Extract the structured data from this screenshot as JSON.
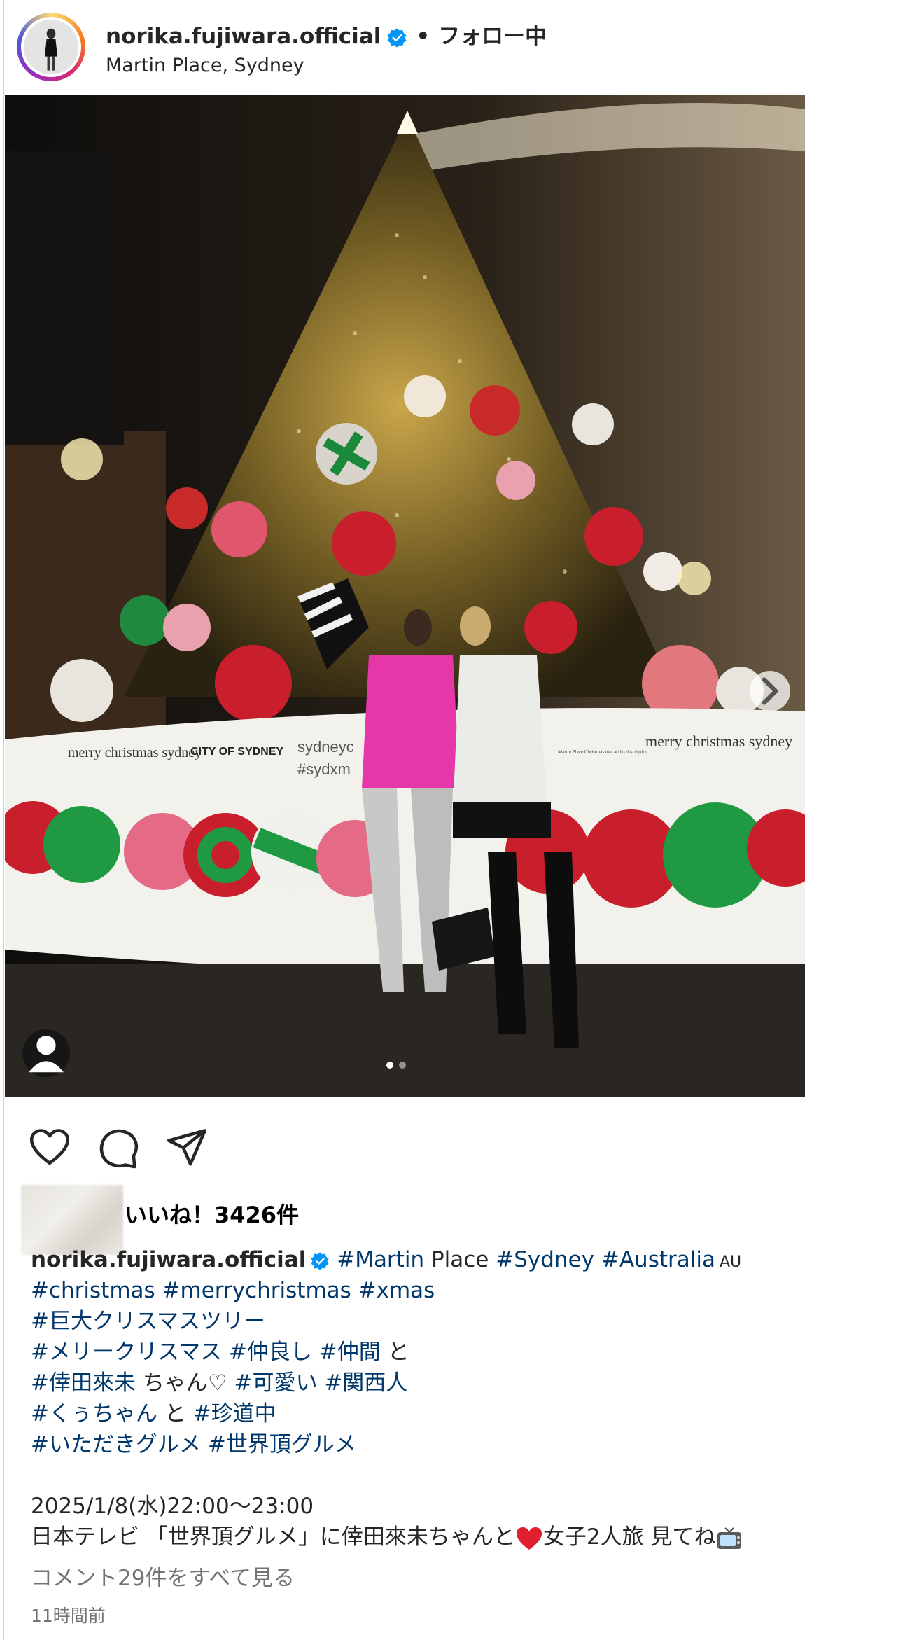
{
  "header": {
    "username": "norika.fujiwara.official",
    "separator": "•",
    "follow_state": "フォロー中",
    "location": "Martin Place, Sydney"
  },
  "photo": {
    "alt_subject": "christmas-tree",
    "banner_text_left": "merry christmas sydney",
    "banner_text_city": "CITY OF SYDNEY",
    "banner_text_mid_1": "sydneyc",
    "banner_text_mid_2": "#sydxm",
    "banner_text_sign": "Martin Place Christmas tree audio description",
    "banner_text_right": "merry christmas sydney",
    "carousel": {
      "count": 2,
      "active": 1
    }
  },
  "actions": {
    "like_icon": "heart-icon",
    "comment_icon": "comment-icon",
    "share_icon": "paper-plane-icon"
  },
  "likes": {
    "label": "いいね！3426件"
  },
  "caption": {
    "username": "norika.fujiwara.official",
    "line1": {
      "t1": "#Martin",
      "t2": " Place ",
      "t3": "#Sydney",
      "t4": " ",
      "t5": "#Australia",
      "t6": "AU"
    },
    "line2": {
      "t1": "#christmas",
      "t2": " ",
      "t3": "#merrychristmas",
      "t4": " ",
      "t5": "#xmas"
    },
    "line3": {
      "t1": "#巨大クリスマスツリー"
    },
    "line4": {
      "t1": "#メリークリスマス",
      "t2": " ",
      "t3": "#仲良し",
      "t4": " ",
      "t5": "#仲間",
      "t6": " と"
    },
    "line5": {
      "t1": "#倖田來未",
      "t2": " ちゃん♡ ",
      "t3": "#可愛い",
      "t4": " ",
      "t5": "#関西人"
    },
    "line6": {
      "t1": "#くぅちゃん",
      "t2": " と ",
      "t3": "#珍道中"
    },
    "line7": {
      "t1": "#いただきグルメ",
      "t2": " ",
      "t3": "#世界頂グルメ"
    },
    "line8": "2025/1/8(水)22:00〜23:00",
    "line9": {
      "t1": "日本テレビ 「世界頂グルメ」に倖田來未ちゃんと",
      "t2": "女子2人旅 見てね"
    }
  },
  "comments_link": "コメント29件をすべて見る",
  "time_ago": "11時間前",
  "colors": {
    "hashtag": "#00376b",
    "verified": "#0095f6",
    "muted": "#737373"
  }
}
